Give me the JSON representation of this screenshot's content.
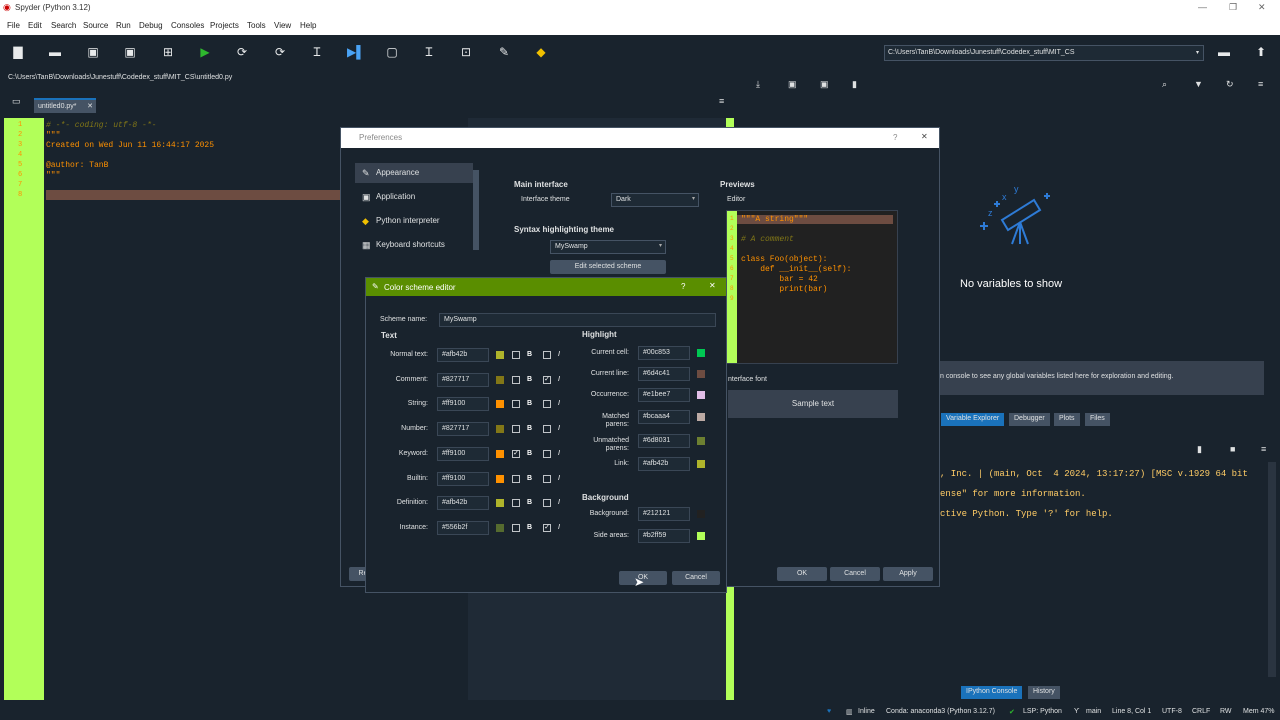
{
  "window": {
    "title": "Spyder (Python 3.12)"
  },
  "menu": [
    "File",
    "Edit",
    "Search",
    "Source",
    "Run",
    "Debug",
    "Consoles",
    "Projects",
    "Tools",
    "View",
    "Help"
  ],
  "toolbar": {
    "path": "C:\\Users\\TanB\\Downloads\\Junestuff\\Codedex_stuff\\MIT_CS"
  },
  "editor": {
    "file_path": "C:\\Users\\TanB\\Downloads\\Junestuff\\Codedex_stuff\\MIT_CS\\untitled0.py",
    "tab": "untitled0.py*",
    "line_numbers": [
      "1",
      "2",
      "3",
      "4",
      "5",
      "6",
      "7",
      "8"
    ],
    "lines": [
      "# -*- coding: utf-8 -*-",
      "\"\"\"",
      "Created on Wed Jun 11 16:44:17 2025",
      "",
      "@author: TanB",
      "\"\"\"",
      "",
      ""
    ]
  },
  "variable_explorer": {
    "empty": "No variables to show",
    "hint": "n console to see any global variables listed here for exploration and editing.",
    "tabs": [
      "Variable Explorer",
      "Debugger",
      "Plots",
      "Files"
    ]
  },
  "console": {
    "lines": [
      ", Inc. | (main, Oct  4 2024, 13:17:27) [MSC v.1929 64 bit",
      "ense\" for more information.",
      "ctive Python. Type '?' for help."
    ],
    "tabs": [
      "IPython Console",
      "History"
    ]
  },
  "status": {
    "inline": "Inline",
    "conda": "Conda: anaconda3 (Python 3.12.7)",
    "lsp": "LSP: Python",
    "git": "main",
    "pos": "Line 8, Col 1",
    "enc": "UTF-8",
    "eol": "CRLF",
    "rw": "RW",
    "mem": "Mem 47%"
  },
  "preferences": {
    "title": "Preferences",
    "help": "?",
    "nav": [
      "Appearance",
      "Application",
      "Python interpreter",
      "Keyboard shortcuts"
    ],
    "main_interface": "Main interface",
    "interface_theme_label": "Interface theme",
    "interface_theme_value": "Dark",
    "syntax_theme": "Syntax highlighting theme",
    "syntax_theme_value": "MySwamp",
    "edit_scheme": "Edit selected scheme",
    "previews": "Previews",
    "editor_label": "Editor",
    "preview_lines": [
      "\"\"\"A string\"\"\"",
      "",
      "# A comment",
      "",
      "class Foo(object):",
      "    def __init__(self):",
      "        bar = 42",
      "        print(bar)"
    ],
    "preview_ln": [
      "1",
      "2",
      "3",
      "4",
      "5",
      "6",
      "7",
      "8",
      "9"
    ],
    "interface_font": "nterface font",
    "sample_text": "Sample text",
    "reset": "Re",
    "ok": "OK",
    "cancel": "Cancel",
    "apply": "Apply"
  },
  "scheme_editor": {
    "title": "Color scheme editor",
    "help": "?",
    "scheme_name_label": "Scheme name:",
    "scheme_name": "MySwamp",
    "text_header": "Text",
    "highlight_header": "Highlight",
    "background_header": "Background",
    "text_rows": [
      {
        "label": "Normal text:",
        "value": "#afb42b",
        "color": "#afb42b",
        "bold": false,
        "italic": false
      },
      {
        "label": "Comment:",
        "value": "#827717",
        "color": "#827717",
        "bold": false,
        "italic": true
      },
      {
        "label": "String:",
        "value": "#ff9100",
        "color": "#ff9100",
        "bold": false,
        "italic": false
      },
      {
        "label": "Number:",
        "value": "#827717",
        "color": "#827717",
        "bold": false,
        "italic": false
      },
      {
        "label": "Keyword:",
        "value": "#ff9100",
        "color": "#ff9100",
        "bold": true,
        "italic": false
      },
      {
        "label": "Builtin:",
        "value": "#ff9100",
        "color": "#ff9100",
        "bold": false,
        "italic": false
      },
      {
        "label": "Definition:",
        "value": "#afb42b",
        "color": "#afb42b",
        "bold": false,
        "italic": false
      },
      {
        "label": "Instance:",
        "value": "#556b2f",
        "color": "#556b2f",
        "bold": false,
        "italic": true
      }
    ],
    "bold_glyph": "B",
    "italic_glyph": "I",
    "highlight_rows": [
      {
        "label": "Current cell:",
        "value": "#00c853",
        "color": "#00c853"
      },
      {
        "label": "Current line:",
        "value": "#6d4c41",
        "color": "#6d4c41"
      },
      {
        "label": "Occurrence:",
        "value": "#e1bee7",
        "color": "#e1bee7"
      },
      {
        "label": "Matched parens:",
        "value": "#bcaaa4",
        "color": "#bcaaa4"
      },
      {
        "label": "Unmatched parens:",
        "value": "#6d8031",
        "color": "#6d8031"
      },
      {
        "label": "Link:",
        "value": "#afb42b",
        "color": "#afb42b"
      }
    ],
    "background_rows": [
      {
        "label": "Background:",
        "value": "#212121",
        "color": "#212121"
      },
      {
        "label": "Side areas:",
        "value": "#b2ff59",
        "color": "#b2ff59"
      }
    ],
    "ok": "OK",
    "cancel": "Cancel"
  }
}
